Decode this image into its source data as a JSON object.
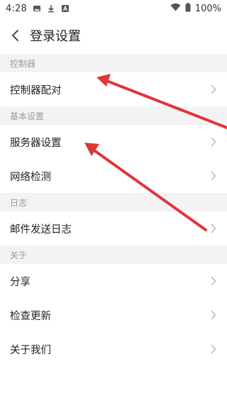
{
  "status_bar": {
    "time": "4:28",
    "battery": "100%",
    "icons": [
      "image-icon",
      "download-icon",
      "app-a-icon",
      "wifi-icon",
      "battery-icon"
    ]
  },
  "header": {
    "title": "登录设置",
    "back_icon": "chevron-left-icon"
  },
  "sections": [
    {
      "title": "控制器",
      "items": [
        {
          "label": "控制器配对"
        }
      ]
    },
    {
      "title": "基本设置",
      "items": [
        {
          "label": "服务器设置"
        },
        {
          "label": "网络检测"
        }
      ]
    },
    {
      "title": "日志",
      "items": [
        {
          "label": "邮件发送日志"
        }
      ]
    },
    {
      "title": "关于",
      "items": [
        {
          "label": "分享"
        },
        {
          "label": "检查更新"
        },
        {
          "label": "关于我们"
        }
      ]
    }
  ],
  "annotations": {
    "arrow_color": "#e0363a"
  },
  "colors": {
    "section_bg": "#f3f3f3",
    "section_text": "#9a9a9a",
    "item_text": "#222222",
    "chevron": "#b5b5b5"
  }
}
